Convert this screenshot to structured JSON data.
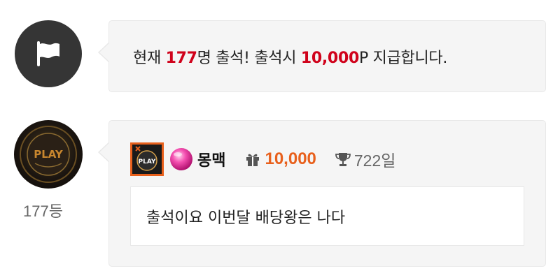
{
  "notice": {
    "prefix": "현재 ",
    "count": "177",
    "middle": "명 출석! 출석시 ",
    "reward": "10,000",
    "suffix": "P 지급합니다."
  },
  "icons": {
    "notice_avatar": "flag-icon",
    "points": "gift-icon",
    "days": "trophy-icon"
  },
  "entry": {
    "avatar_text": "PLAY",
    "rank": "177등",
    "badge_text": "PLAY",
    "nickname": "몽맥",
    "points": "10,000",
    "days": "722일",
    "comment": "출석이요 이번달 배당왕은 나다"
  },
  "colors": {
    "highlight_red": "#d0021b",
    "points_orange": "#e8601c",
    "bubble_bg": "#f5f5f5"
  }
}
